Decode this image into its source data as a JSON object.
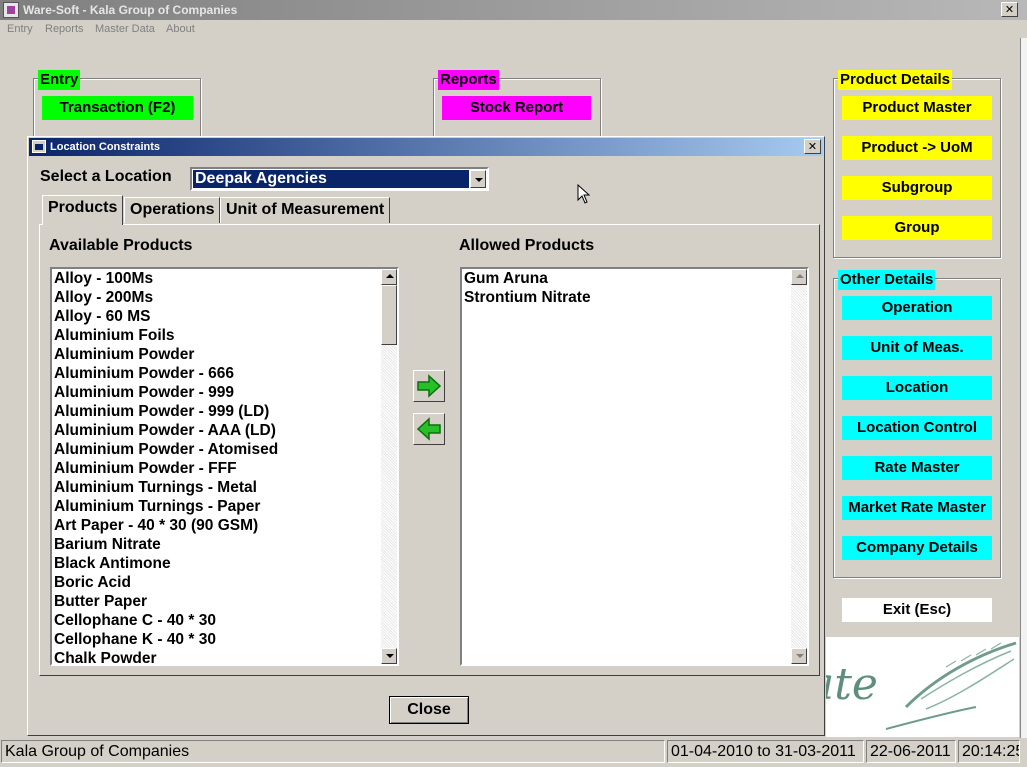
{
  "window": {
    "title": "Ware-Soft - Kala Group of Companies",
    "close_glyph": "✕"
  },
  "menu": [
    "Entry",
    "Reports",
    "Master Data",
    "About"
  ],
  "entry_group": {
    "label": "Entry",
    "buttons": [
      "Transaction (F2)"
    ]
  },
  "reports_group": {
    "label": "Reports",
    "buttons": [
      "Stock Report"
    ]
  },
  "product_details": {
    "label": "Product Details",
    "buttons": [
      "Product Master",
      "Product -> UoM",
      "Subgroup",
      "Group"
    ]
  },
  "other_details": {
    "label": "Other Details",
    "buttons": [
      "Operation",
      "Unit of Meas.",
      "Location",
      "Location Control",
      "Rate Master",
      "Market Rate Master",
      "Company Details"
    ]
  },
  "exit_button": "Exit (Esc)",
  "dialog": {
    "title": "Location Constraints",
    "close_glyph": "✕",
    "location_label": "Select a Location",
    "location_value": "Deepak Agencies",
    "tabs": [
      "Products",
      "Operations",
      "Unit of Measurement"
    ],
    "available_label": "Available Products",
    "allowed_label": "Allowed Products",
    "available_products": [
      "Alloy - 100Ms",
      "Alloy - 200Ms",
      "Alloy - 60 MS",
      "Aluminium Foils",
      "Aluminium Powder",
      "Aluminium Powder - 666",
      "Aluminium Powder - 999",
      "Aluminium Powder - 999 (LD)",
      "Aluminium Powder - AAA (LD)",
      "Aluminium Powder - Atomised",
      "Aluminium Powder - FFF",
      "Aluminium Turnings - Metal",
      "Aluminium Turnings - Paper",
      "Art Paper -  40 * 30 (90 GSM)",
      "Barium Nitrate",
      "Black Antimone",
      "Boric Acid",
      "Butter Paper",
      "Cellophane C - 40 * 30",
      "Cellophane K - 40 * 30",
      "Chalk Powder"
    ],
    "allowed_products": [
      "Gum Aruna",
      "Strontium Nitrate"
    ],
    "close_button": "Close"
  },
  "status": {
    "company": "Kala Group of Companies",
    "period": "01-04-2010 to 31-03-2011",
    "date": "22-06-2011",
    "time": "20:14:25"
  },
  "colors": {
    "entry": "#00ff00",
    "reports": "#ff00ff",
    "product_details": "#ffff00",
    "other_details": "#00ffff",
    "dialog_title": "#0a246a"
  }
}
